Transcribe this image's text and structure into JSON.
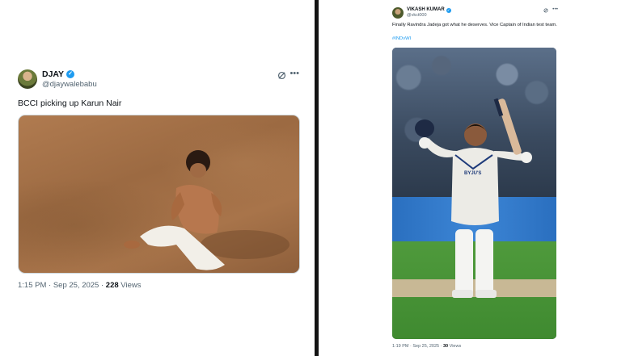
{
  "left_tweet": {
    "display_name": "DJAY",
    "handle": "@djaywalebabu",
    "text": "BCCI picking up Karun Nair",
    "time": "1:15 PM · Sep 25, 2025 · ",
    "views_count": "228",
    "views_label": " Views",
    "icons": [
      "verified-badge",
      "grok-icon",
      "more-icon"
    ]
  },
  "right_tweet": {
    "display_name": "VIKASH KUMAR",
    "handle": "@vkct000",
    "text": "Finally Ravindra Jadeja got what he deserves. Vice Captain of Indian test team.",
    "hashtag": "#INDvWI",
    "time": "1:19 PM · Sep 25, 2025 · ",
    "views_count": "30",
    "views_label": " Views",
    "sponsor_text": "BYJU'S",
    "icons": [
      "verified-badge",
      "grok-icon",
      "more-icon"
    ]
  },
  "colors": {
    "verified": "#1d9bf0",
    "secondary_text": "#536471",
    "divider": "#141414"
  }
}
